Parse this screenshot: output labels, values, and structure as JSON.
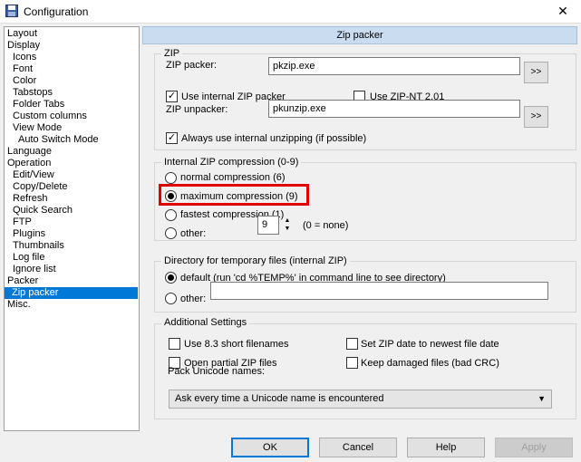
{
  "window": {
    "title": "Configuration",
    "close_glyph": "✕"
  },
  "tree": {
    "items": [
      {
        "label": "Layout",
        "level": 0
      },
      {
        "label": "Display",
        "level": 0
      },
      {
        "label": "Icons",
        "level": 1
      },
      {
        "label": "Font",
        "level": 1
      },
      {
        "label": "Color",
        "level": 1
      },
      {
        "label": "Tabstops",
        "level": 1
      },
      {
        "label": "Folder Tabs",
        "level": 1
      },
      {
        "label": "Custom columns",
        "level": 1
      },
      {
        "label": "View Mode",
        "level": 1
      },
      {
        "label": "Auto Switch Mode",
        "level": 2
      },
      {
        "label": "Language",
        "level": 0
      },
      {
        "label": "Operation",
        "level": 0
      },
      {
        "label": "Edit/View",
        "level": 1
      },
      {
        "label": "Copy/Delete",
        "level": 1
      },
      {
        "label": "Refresh",
        "level": 1
      },
      {
        "label": "Quick Search",
        "level": 1
      },
      {
        "label": "FTP",
        "level": 1
      },
      {
        "label": "Plugins",
        "level": 1
      },
      {
        "label": "Thumbnails",
        "level": 1
      },
      {
        "label": "Log file",
        "level": 1
      },
      {
        "label": "Ignore list",
        "level": 1
      },
      {
        "label": "Packer",
        "level": 0
      },
      {
        "label": "Zip packer",
        "level": 1,
        "selected": true
      },
      {
        "label": "Misc.",
        "level": 0
      }
    ]
  },
  "panel": {
    "header": "Zip packer",
    "zip": {
      "group_label": "ZIP",
      "packer_label": "ZIP packer:",
      "packer_value": "pkzip.exe",
      "browse1": ">>",
      "use_internal_packer": "Use internal ZIP packer",
      "use_zip_nt": "Use ZIP-NT 2.01",
      "unpacker_label": "ZIP unpacker:",
      "unpacker_value": "pkunzip.exe",
      "browse2": ">>",
      "always_internal_unzip": "Always use internal unzipping (if possible)"
    },
    "compression": {
      "group_label": "Internal ZIP compression (0-9)",
      "normal": "normal compression (6)",
      "maximum": "maximum compression (9)",
      "fastest": "fastest compression (1)",
      "other": "other:",
      "other_value": "9",
      "none_hint": "(0 = none)"
    },
    "tempdir": {
      "group_label": "Directory for temporary files (internal ZIP)",
      "default": "default (run 'cd %TEMP%' in command line to see directory)",
      "other": "other:",
      "other_value": ""
    },
    "additional": {
      "group_label": "Additional Settings",
      "short_names": "Use 8.3 short filenames",
      "set_date": "Set ZIP date to newest file date",
      "open_partial": "Open partial ZIP files",
      "keep_damaged": "Keep damaged files (bad CRC)",
      "unicode_label": "Pack Unicode names:",
      "unicode_value": "Ask every time a Unicode name is encountered"
    }
  },
  "buttons": {
    "ok": "OK",
    "cancel": "Cancel",
    "help": "Help",
    "apply": "Apply"
  },
  "colors": {
    "selection": "#0078d7",
    "header": "#c9dcf0",
    "highlight": "#e00000"
  }
}
